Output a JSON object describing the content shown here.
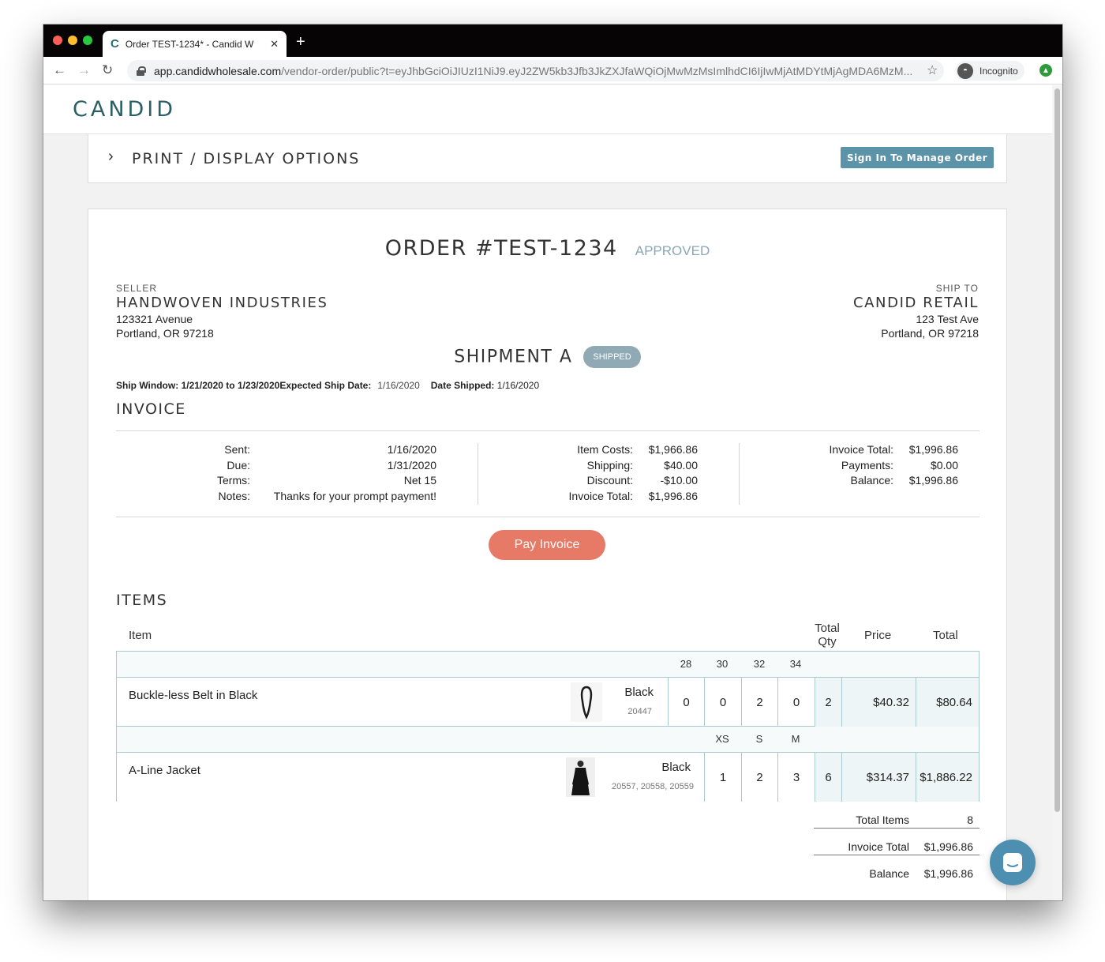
{
  "browser": {
    "tab_title": "Order TEST-1234* - Candid W",
    "tab_favicon": "C",
    "url_host": "app.candidwholesale.com",
    "url_path": "/vendor-order/public?t=eyJhbGciOiJIUzI1NiJ9.eyJ2ZW5kb3Jfb3JkZXJfaWQiOjMwMzMsImlhdCI6IjIwMjAtMDYtMjAgMDA6MzM...",
    "incognito_label": "Incognito",
    "icons": [
      "back-arrow-icon",
      "forward-arrow-icon",
      "reload-icon",
      "lock-icon",
      "star-icon",
      "incognito-icon",
      "extension-icon",
      "close-icon",
      "plus-icon"
    ]
  },
  "brand": {
    "logo": "CANDID"
  },
  "options": {
    "title": "PRINT / DISPLAY OPTIONS",
    "sign_in_label": "Sign In To Manage Order"
  },
  "order": {
    "number": "ORDER #TEST-1234",
    "status": "APPROVED",
    "seller": {
      "label": "SELLER",
      "name": "HANDWOVEN INDUSTRIES",
      "address1": "123321 Avenue",
      "address2": "Portland, OR 97218"
    },
    "ship_to": {
      "label": "SHIP TO",
      "name": "CANDID RETAIL",
      "address1": "123 Test Ave",
      "address2": "Portland, OR 97218"
    },
    "shipment": {
      "title": "SHIPMENT A",
      "badge": "SHIPPED",
      "ship_window_label": "Ship Window:",
      "ship_window_value": "1/21/2020 to 1/23/2020",
      "expected_label": "Expected Ship Date:",
      "expected_value": "1/16/2020",
      "shipped_label": "Date Shipped:",
      "shipped_value": "1/16/2020"
    }
  },
  "invoice": {
    "title": "INVOICE",
    "col1": [
      {
        "label": "Sent:",
        "value": "1/16/2020"
      },
      {
        "label": "Due:",
        "value": "1/31/2020"
      },
      {
        "label": "Terms:",
        "value": "Net 15"
      },
      {
        "label": "Notes:",
        "value": "Thanks for your prompt payment!"
      }
    ],
    "col2": [
      {
        "label": "Item Costs:",
        "value": "$1,966.86"
      },
      {
        "label": "Shipping:",
        "value": "$40.00"
      },
      {
        "label": "Discount:",
        "value": "-$10.00"
      },
      {
        "label": "Invoice Total:",
        "value": "$1,996.86"
      }
    ],
    "col3": [
      {
        "label": "Invoice Total:",
        "value": "$1,996.86"
      },
      {
        "label": "Payments:",
        "value": "$0.00"
      },
      {
        "label": "Balance:",
        "value": "$1,996.86"
      }
    ],
    "pay_label": "Pay Invoice"
  },
  "items": {
    "title": "ITEMS",
    "headers": {
      "item": "Item",
      "total_qty": "Total Qty",
      "price": "Price",
      "total": "Total"
    },
    "rows": [
      {
        "name": "Buckle-less Belt in Black",
        "color": "Black",
        "sku": "20447",
        "sizes": [
          "28",
          "30",
          "32",
          "34"
        ],
        "quantities": [
          "0",
          "0",
          "2",
          "0"
        ],
        "total_qty": "2",
        "price": "$40.32",
        "total": "$80.64"
      },
      {
        "name": "A-Line Jacket",
        "color": "Black",
        "sku": "20557, 20558, 20559",
        "sizes": [
          "XS",
          "S",
          "M"
        ],
        "quantities": [
          "1",
          "2",
          "3"
        ],
        "total_qty": "6",
        "price": "$314.37",
        "total": "$1,886.22"
      }
    ]
  },
  "summary": {
    "total_items_label": "Total Items",
    "total_items_value": "8",
    "invoice_total_label": "Invoice Total",
    "invoice_total_value": "$1,996.86",
    "balance_label": "Balance",
    "balance_value": "$1,996.86"
  },
  "colors": {
    "brand": "#2c5f65",
    "button_blue": "#5b93a9",
    "pay_button": "#e77a66",
    "status_gray": "#8fa9b5",
    "table_border": "#a9c9cf",
    "chat_button": "#4d8fb1"
  }
}
